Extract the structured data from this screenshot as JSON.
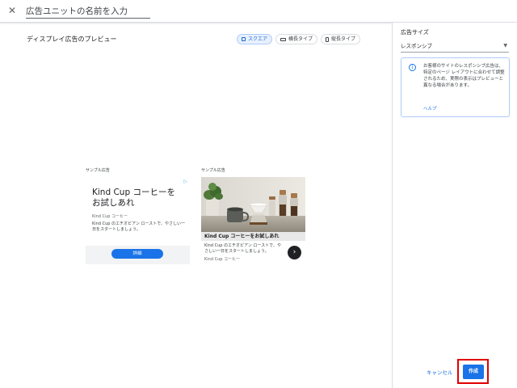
{
  "header": {
    "close_icon": "close-icon",
    "ad_unit_name_placeholder": "広告ユニットの名前を入力"
  },
  "preview": {
    "title": "ディスプレイ広告のプレビュー",
    "toggles": [
      {
        "label": "スクエア",
        "icon": "square-icon",
        "active": true
      },
      {
        "label": "横長タイプ",
        "icon": "landscape-icon",
        "active": false
      },
      {
        "label": "縦長タイプ",
        "icon": "portrait-icon",
        "active": false
      }
    ],
    "sample_label": "サンプル広告"
  },
  "ad1": {
    "headline": "Kind Cup コーヒーを お試しあれ",
    "brand": "Kind Cup コーヒー",
    "description": "Kind Cup のエチオピアン ローストで、やさしい一日をスタートしましょう。",
    "button": "詳細",
    "adchoices_icon": "adchoices-icon"
  },
  "ad2": {
    "headline": "Kind Cup コーヒーをお試しあれ",
    "description": "Kind Cup のエチオピアン ローストで、やさしい一日をスタートしましょう。",
    "brand": "Kind Cup コーヒー",
    "arrow_icon": "chevron-right-icon"
  },
  "right_panel": {
    "title": "広告サイズ",
    "size_value": "レスポンシブ",
    "info_text": "お客様のサイトのレスポンシブ広告は、特定のページ レイアウトに合わせて調整されるため、実際の表示はプレビューと異なる場合があります。",
    "help_link": "ヘルプ"
  },
  "actions": {
    "cancel": "キャンセル",
    "create": "作成"
  },
  "colors": {
    "accent": "#1a73e8",
    "highlight_border": "#e00000"
  }
}
